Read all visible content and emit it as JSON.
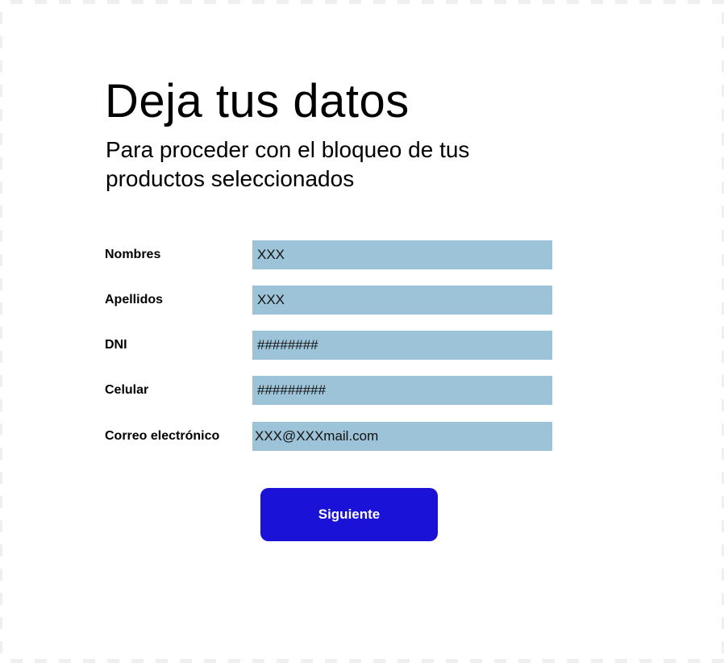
{
  "header": {
    "title": "Deja tus datos",
    "subtitle": "Para proceder con el bloqueo de tus productos seleccionados"
  },
  "form": {
    "fields": [
      {
        "label": "Nombres",
        "value": "XXX"
      },
      {
        "label": "Apellidos",
        "value": "XXX"
      },
      {
        "label": "DNI",
        "value": "########"
      },
      {
        "label": "Celular",
        "value": "#########"
      },
      {
        "label": "Correo electrónico",
        "value": "XXX@XXXmail.com"
      }
    ],
    "submit_label": "Siguiente"
  },
  "colors": {
    "field_bg": "#9dc3d8",
    "button_bg": "#1a12d6"
  }
}
